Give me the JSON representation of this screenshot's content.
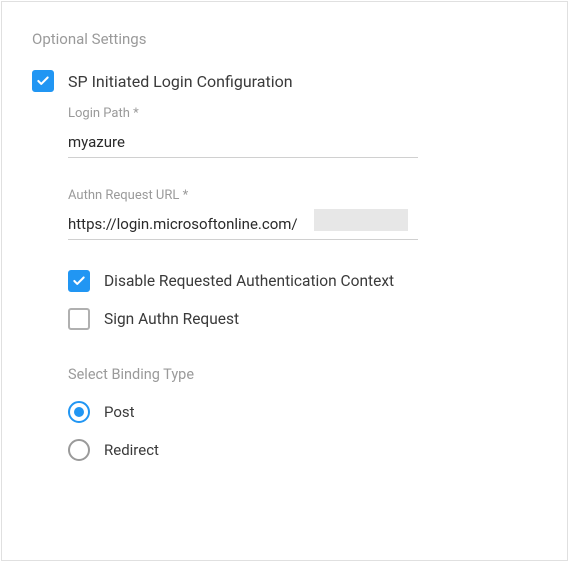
{
  "section_title": "Optional Settings",
  "sp_initiated": {
    "checked": true,
    "label": "SP Initiated Login Configuration",
    "login_path": {
      "label": "Login Path *",
      "value": "myazure"
    },
    "authn_url": {
      "label": "Authn Request URL *",
      "value": "https://login.microsoftonline.com/                         e"
    },
    "disable_rac": {
      "checked": true,
      "label": "Disable Requested Authentication Context"
    },
    "sign_authn": {
      "checked": false,
      "label": "Sign Authn Request"
    },
    "binding": {
      "title": "Select Binding Type",
      "selected": "post",
      "options": {
        "post": "Post",
        "redirect": "Redirect"
      }
    }
  }
}
